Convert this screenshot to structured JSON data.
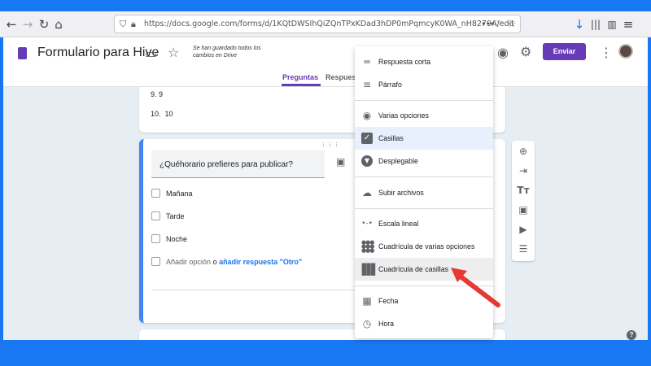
{
  "browser": {
    "url": "https://docs.google.com/forms/d/1KQtDWSIhQiZQnTPxKDad3hDP0mPqmcyK0WA_nH8279A/edit",
    "url_more": "•••"
  },
  "app": {
    "title": "Formulario para Hive",
    "saved_status": "Se han guardado todos los cambios en Drive",
    "send_button": "Enviar",
    "brand_color": "#673ab7"
  },
  "tabs": [
    {
      "label": "Preguntas",
      "active": true
    },
    {
      "label": "Respuestas",
      "active": false
    }
  ],
  "previous_card": {
    "options": [
      {
        "num": "9.",
        "label": "9"
      },
      {
        "num": "10.",
        "label": "10"
      }
    ]
  },
  "question": {
    "title": "¿Quéhorario prefieres para publicar?",
    "options": [
      "Mañana",
      "Tarde",
      "Noche"
    ],
    "add_option": "Añadir opción",
    "or": "o",
    "add_other": "añadir respuesta \"Otro\""
  },
  "type_menu": {
    "items": [
      {
        "label": "Respuesta corta",
        "icon": "short-text-icon"
      },
      {
        "label": "Párrafo",
        "icon": "paragraph-icon"
      },
      {
        "label": "Varias opciones",
        "icon": "radio-icon"
      },
      {
        "label": "Casillas",
        "icon": "checkbox-icon",
        "selected": true
      },
      {
        "label": "Desplegable",
        "icon": "dropdown-icon"
      },
      {
        "label": "Subir archivos",
        "icon": "cloud-upload-icon"
      },
      {
        "label": "Escala lineal",
        "icon": "linear-scale-icon"
      },
      {
        "label": "Cuadrícula de varias opciones",
        "icon": "grid-dots-icon"
      },
      {
        "label": "Cuadrícula de casillas",
        "icon": "grid-squares-icon",
        "hover": true
      },
      {
        "label": "Fecha",
        "icon": "calendar-icon"
      },
      {
        "label": "Hora",
        "icon": "clock-icon"
      }
    ]
  },
  "colors": {
    "accent_blue": "#4285f4",
    "selected_bg": "#e8f0fe",
    "arrow": "#e53935"
  }
}
